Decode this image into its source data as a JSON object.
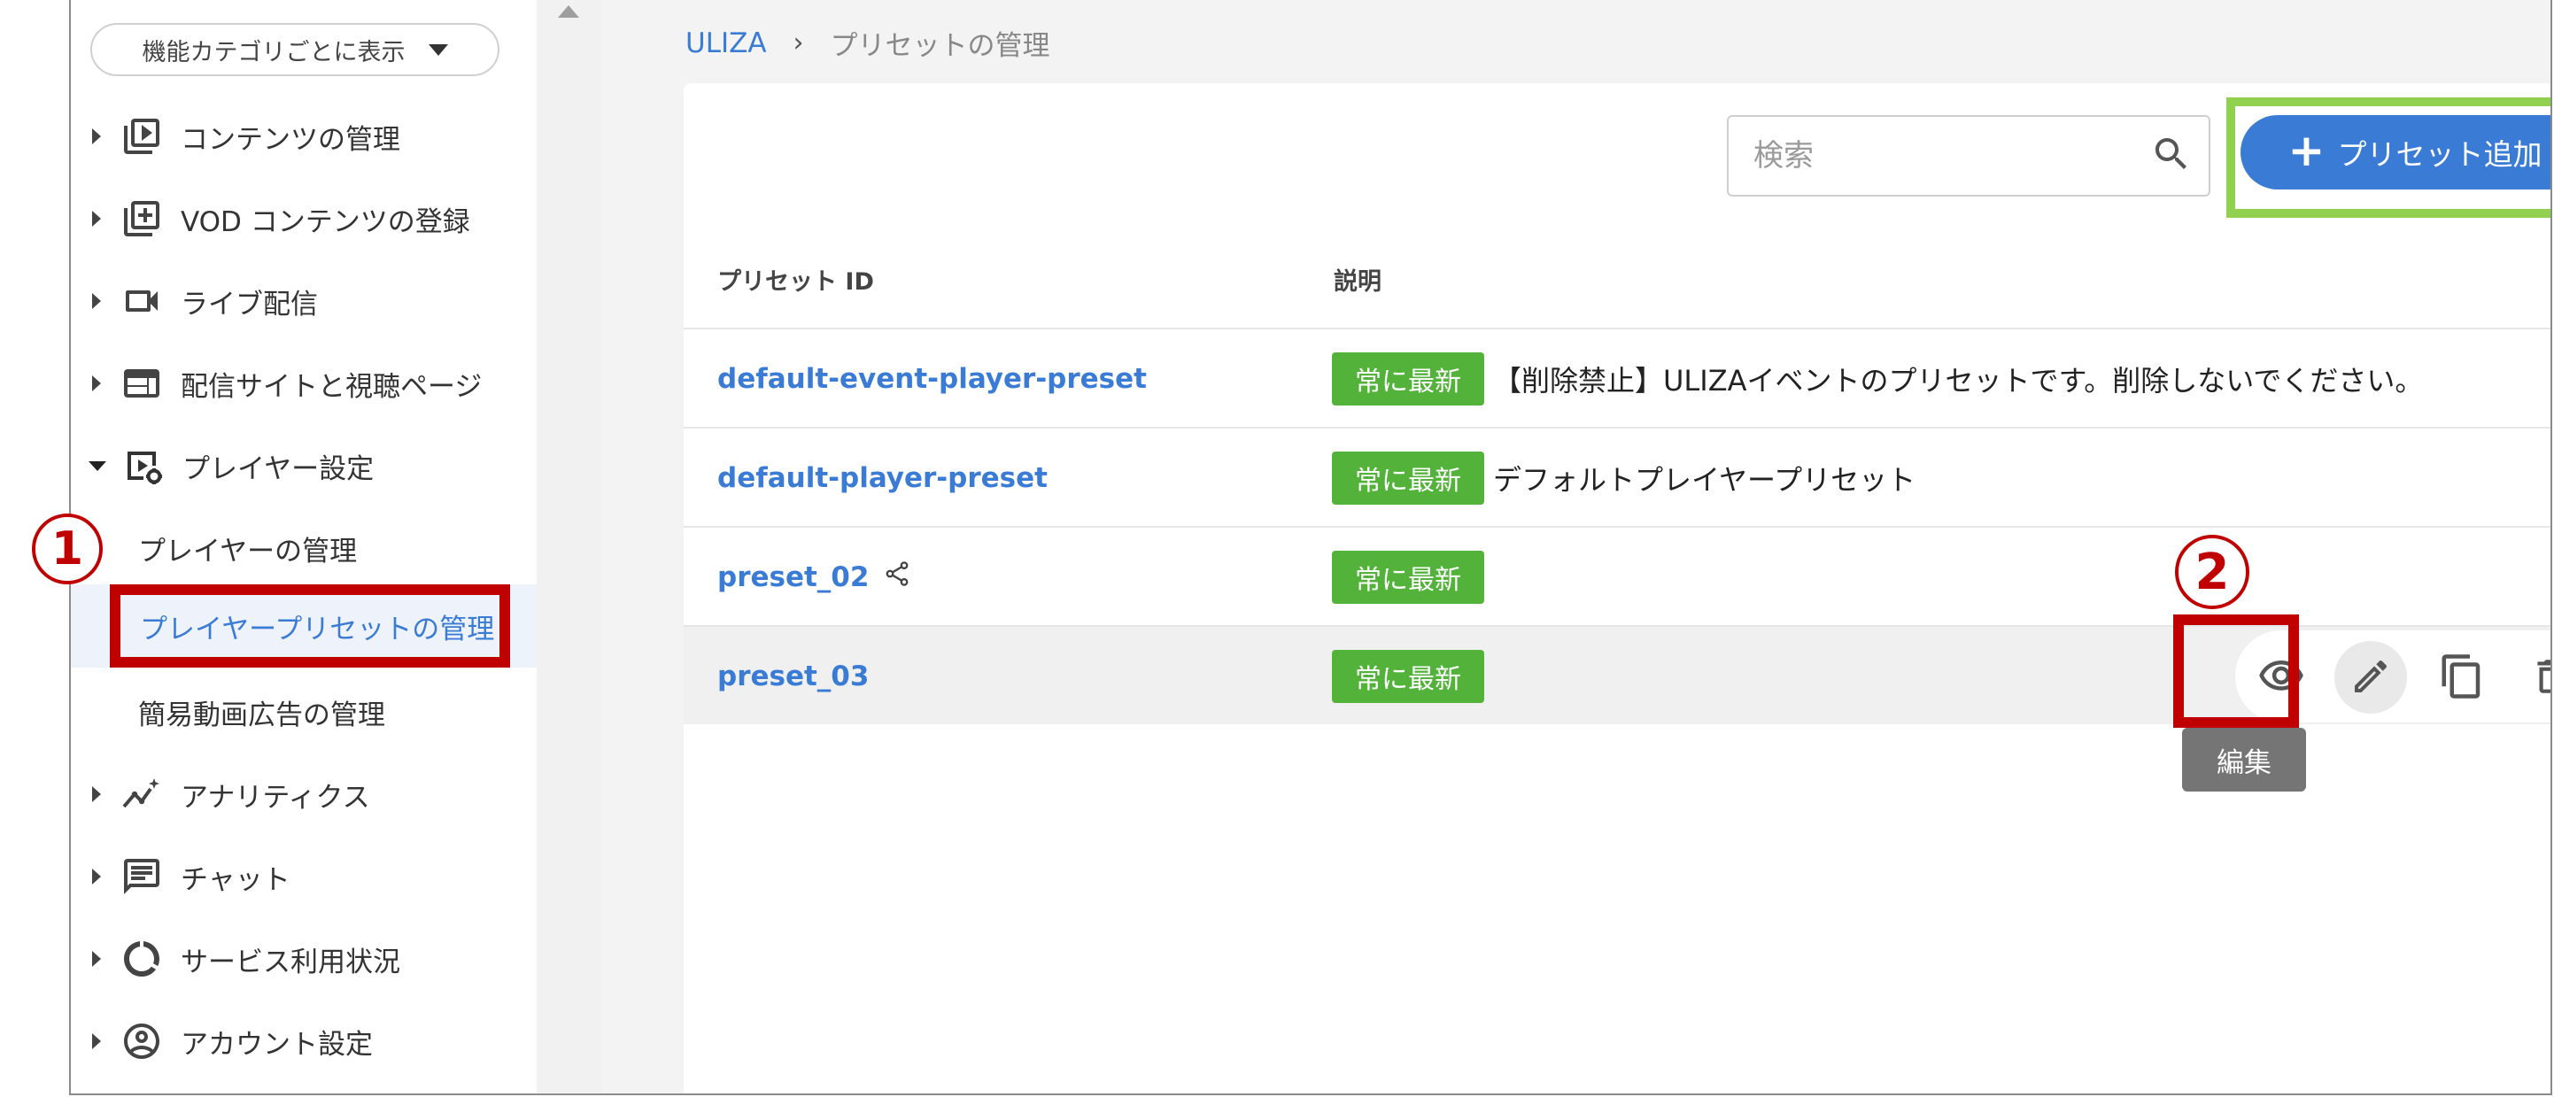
{
  "sidebar": {
    "category_select": "機能カテゴリごとに表示",
    "items": [
      {
        "label": "コンテンツの管理",
        "icon": "play-library-icon"
      },
      {
        "label": "VOD コンテンツの登録",
        "icon": "add-library-icon"
      },
      {
        "label": "ライブ配信",
        "icon": "videocam-icon"
      },
      {
        "label": "配信サイトと視聴ページ",
        "icon": "web-layout-icon"
      },
      {
        "label": "プレイヤー設定",
        "icon": "player-settings-icon",
        "expanded": true
      },
      {
        "label": "アナリティクス",
        "icon": "analytics-icon"
      },
      {
        "label": "チャット",
        "icon": "chat-icon"
      },
      {
        "label": "サービス利用状況",
        "icon": "usage-donut-icon"
      },
      {
        "label": "アカウント設定",
        "icon": "account-icon"
      }
    ],
    "sub_items": [
      {
        "label": "プレイヤーの管理"
      },
      {
        "label": "プレイヤープリセットの管理",
        "active": true
      },
      {
        "label": "簡易動画広告の管理"
      }
    ]
  },
  "annotations": {
    "badge_1": "1",
    "badge_2": "2",
    "highlight_color": "#c00000",
    "add_highlight_color": "#92d050"
  },
  "breadcrumb": {
    "root": "ULIZA",
    "separator": "›",
    "current": "プリセットの管理"
  },
  "toolbar": {
    "search_placeholder": "検索",
    "add_label": "プリセット追加",
    "add_plus": "+"
  },
  "table": {
    "headers": {
      "id": "プリセット ID",
      "desc": "説明"
    },
    "tag_label": "常に最新",
    "rows": [
      {
        "id": "default-event-player-preset",
        "desc": "【削除禁止】ULIZAイベントのプリセットです。削除しないでください。"
      },
      {
        "id": "default-player-preset",
        "desc": "デフォルトプレイヤープリセット"
      },
      {
        "id": "preset_02",
        "desc": "",
        "shared": true
      },
      {
        "id": "preset_03",
        "desc": "",
        "hovered": true
      }
    ]
  },
  "row_actions": {
    "tooltip": "編集",
    "icons": [
      "eye-icon",
      "edit-pencil-icon",
      "copy-icon",
      "delete-icon"
    ]
  },
  "colors": {
    "accent": "#3a7bd5",
    "tag_green": "#52b23a"
  }
}
